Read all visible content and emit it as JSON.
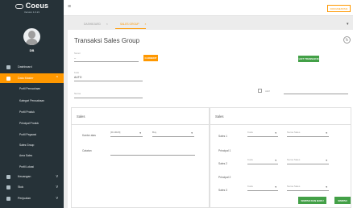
{
  "app": {
    "name": "Coeus",
    "version": "Version 1.0.21",
    "user": "DB"
  },
  "sidebar": {
    "items": [
      {
        "label": "Dashboard",
        "icon": "dashboard-icon"
      },
      {
        "label": "Data Master",
        "icon": "folder-icon",
        "chevron": "^"
      },
      {
        "label": "Keuangan",
        "icon": "money-icon",
        "chevron": "v"
      },
      {
        "label": "Stok",
        "icon": "box-icon",
        "chevron": "v"
      },
      {
        "label": "Penjualan",
        "icon": "cart-icon",
        "chevron": "v"
      }
    ],
    "sub_items": [
      "Profil Perusahaan",
      "Kategori Perusahaan",
      "Profil Produk",
      "Principal Produk",
      "Profil Pegawai",
      "Sales Group",
      "Area Sales",
      "Profil Lokasi"
    ]
  },
  "topbar": {
    "menu_icon": "hamburger-icon",
    "right_button": "DOKUMENTASI"
  },
  "tabs": [
    {
      "label": "DASHBOARD",
      "close": "×"
    },
    {
      "label": "SALES GROUP",
      "close": "×"
    }
  ],
  "tabs_more": "▾",
  "form": {
    "title": "Transaksi Sales Group",
    "refresh_icon": "↻",
    "number": {
      "label": "Nomor",
      "value": "--"
    },
    "search_button": "CARI/EDIT",
    "list_button": "LIST TRANSAKSI",
    "kode": {
      "label": "Kode",
      "value": "AUTO"
    },
    "nama": {
      "label": "Nama"
    },
    "aktif_label": "Aktif",
    "sales_left": {
      "title": "Sales",
      "row_label": "Kantor atas",
      "select1": "[ID-0029]",
      "select2": "Buy",
      "catatan_label": "Catatan"
    },
    "sales_right": {
      "title": "Sales",
      "rows": [
        {
          "label": "Sales 1",
          "s1": "Kode",
          "s2": "Nama Sales"
        },
        {
          "label": "Principal 1",
          "s1": "",
          "s2": ""
        },
        {
          "label": "Sales 2",
          "s1": "Kode",
          "s2": "Nama Sales"
        },
        {
          "label": "Principal 2",
          "s1": "",
          "s2": ""
        },
        {
          "label": "Sales 3",
          "s1": "Kode",
          "s2": "Nama Sales"
        }
      ]
    },
    "save_new_button": "SIMPAN DAN BARU",
    "save_button": "SIMPAN"
  }
}
